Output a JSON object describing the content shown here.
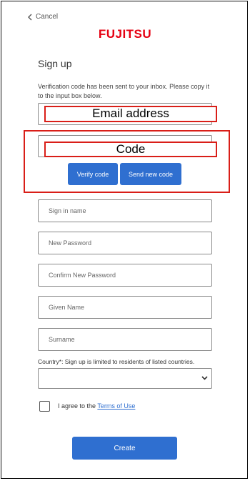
{
  "header": {
    "cancel_label": "Cancel",
    "brand_logo_text": "FUJITSU"
  },
  "form": {
    "title": "Sign up",
    "verification_message": "Verification code has been sent to your inbox. Please copy it to the input box below.",
    "email_overlay_label": "Email address",
    "code_overlay_label": "Code",
    "verify_code_label": "Verify code",
    "send_new_code_label": "Send new code",
    "signin_name_placeholder": "Sign in name",
    "new_password_placeholder": "New Password",
    "confirm_password_placeholder": "Confirm New Password",
    "given_name_placeholder": "Given Name",
    "surname_placeholder": "Surname",
    "country_label": "Country*: Sign up is limited to residents of listed countries.",
    "country_selected": "",
    "agree_prefix": "I agree to the ",
    "terms_link": "Terms of Use",
    "create_label": "Create"
  },
  "colors": {
    "accent": "#2f6fd0",
    "brand_red": "#e60012",
    "highlight_red": "#d91e18"
  },
  "icons": [
    "chevron-left-icon",
    "chevron-down-icon"
  ]
}
